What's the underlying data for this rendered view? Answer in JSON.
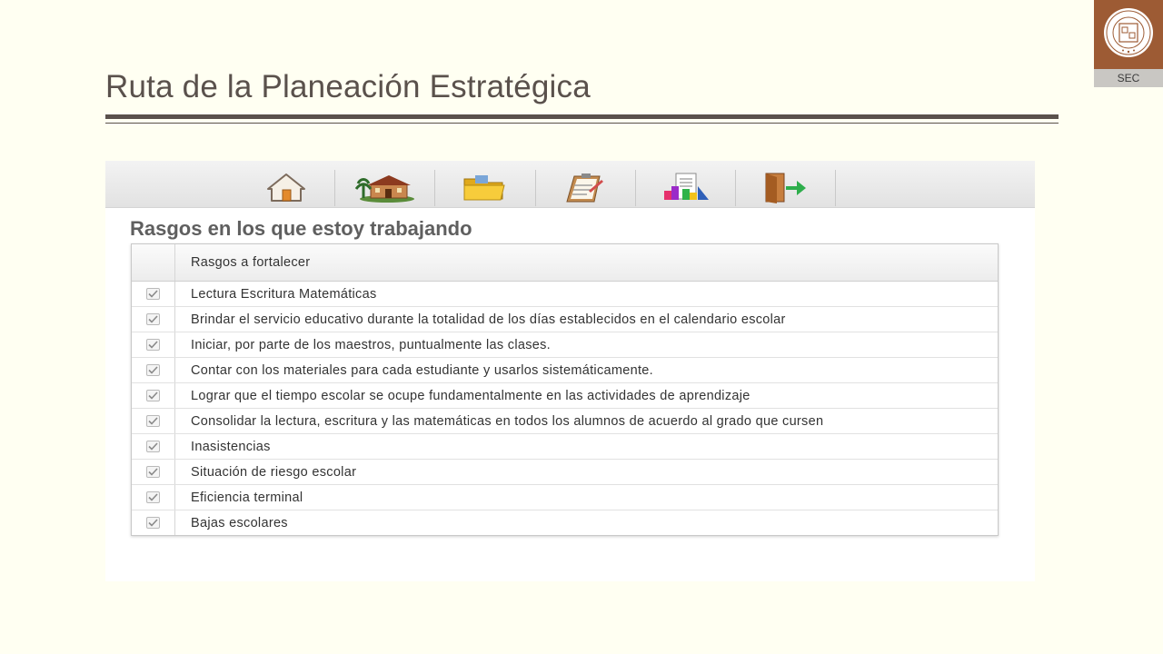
{
  "slide": {
    "title": "Ruta de la Planeación Estratégica"
  },
  "logo": {
    "label": "SEC"
  },
  "toolbar": {
    "items": [
      {
        "icon": "home-icon"
      },
      {
        "icon": "school-building-icon"
      },
      {
        "icon": "folder-icon"
      },
      {
        "icon": "clipboard-icon"
      },
      {
        "icon": "report-chart-icon"
      },
      {
        "icon": "exit-door-icon"
      }
    ]
  },
  "section": {
    "heading": "Rasgos en los que estoy trabajando"
  },
  "table": {
    "column_header": "Rasgos a fortalecer",
    "rows": [
      {
        "text": "Lectura Escritura Matemáticas",
        "checked": true
      },
      {
        "text": "Brindar el servicio educativo durante la totalidad de los días establecidos en el calendario escolar",
        "checked": true
      },
      {
        "text": "Iniciar, por parte de los maestros, puntualmente las clases.",
        "checked": true
      },
      {
        "text": "Contar con los materiales para cada estudiante y usarlos sistemáticamente.",
        "checked": true
      },
      {
        "text": "Lograr que el tiempo escolar se ocupe fundamentalmente en las actividades de aprendizaje",
        "checked": true
      },
      {
        "text": "Consolidar la lectura, escritura y las matemáticas en todos los alumnos de acuerdo al grado que cursen",
        "checked": true
      },
      {
        "text": "Inasistencias",
        "checked": true
      },
      {
        "text": "Situación de riesgo escolar",
        "checked": true
      },
      {
        "text": "Eficiencia terminal",
        "checked": true
      },
      {
        "text": "Bajas escolares",
        "checked": true
      }
    ]
  },
  "colors": {
    "background": "#fffff2",
    "title_text": "#5a514c",
    "logo_brown": "#9d5b34",
    "checkmark": "#8a8a8a"
  }
}
